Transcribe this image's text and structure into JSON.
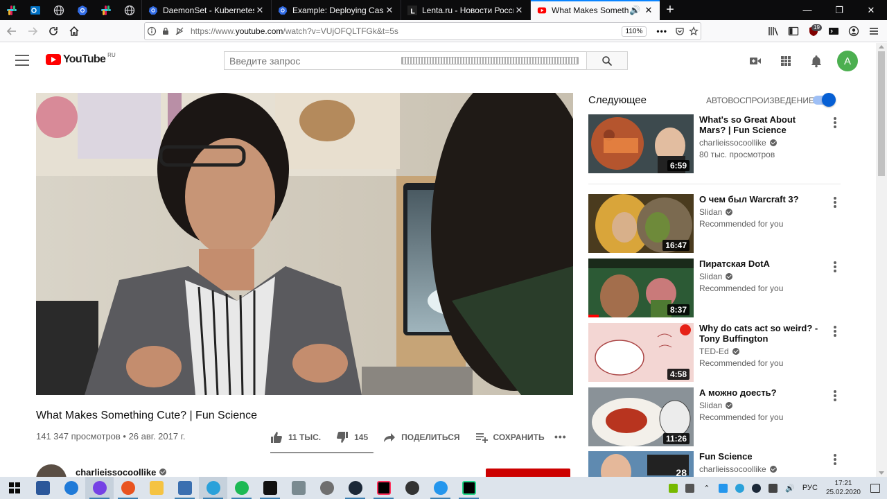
{
  "browser": {
    "pinned_tabs": [
      {
        "icon": "slack-icon",
        "color": "#e01e5a"
      },
      {
        "icon": "outlook-icon",
        "color": "#0072c6"
      },
      {
        "icon": "globe-icon",
        "color": "#d7d7db"
      },
      {
        "icon": "kubernetes-icon",
        "color": "#326ce5"
      },
      {
        "icon": "slack-icon",
        "color": "#e01e5a"
      },
      {
        "icon": "globe-icon",
        "color": "#d7d7db"
      }
    ],
    "tabs": [
      {
        "title": "DaemonSet - Kubernetes",
        "icon": "kubernetes-icon"
      },
      {
        "title": "Example: Deploying Cassandra",
        "icon": "kubernetes-icon"
      },
      {
        "title": "Lenta.ru - Новости России и м",
        "icon": "lenta-icon"
      },
      {
        "title": "What Makes Something Cut",
        "icon": "youtube-icon"
      }
    ],
    "url_prefix": "https://www.",
    "url_host": "youtube.com",
    "url_path": "/watch?v=VUjOFQLTFGk&t=5s",
    "zoom": "110%",
    "addon_badge": "19"
  },
  "youtube": {
    "logo_text": "YouTube",
    "region": "RU",
    "search_placeholder": "Введите запрос",
    "avatar_letter": "A",
    "brand_color": "#ff0000",
    "accent_color": "#065fd4"
  },
  "video": {
    "title": "What Makes Something Cute? | Fun Science",
    "meta": "141 347 просмотров • 26 авг. 2017 г.",
    "likes": "11 ТЫС.",
    "dislikes": "145",
    "share_label": "ПОДЕЛИТЬСЯ",
    "save_label": "СОХРАНИТЬ",
    "like_ratio": 0.987,
    "channel": "charlieissocoollike"
  },
  "sidebar": {
    "up_next": "Следующее",
    "autoplay": "АВТОВОСПРОИЗВЕДЕНИЕ",
    "autoplay_on": true,
    "items": [
      {
        "title": "What's so Great About Mars? | Fun Science",
        "channel": "charlieissocoollike",
        "stat": "80 тыс. просмотров",
        "duration": "6:59",
        "progress": 0
      },
      {
        "title": "О чем был Warcraft 3?",
        "channel": "Slidan",
        "stat": "Recommended for you",
        "duration": "16:47",
        "progress": 0
      },
      {
        "title": "Пиратская DotA",
        "channel": "Slidan",
        "stat": "Recommended for you",
        "duration": "8:37",
        "progress": 0.1
      },
      {
        "title": "Why do cats act so weird? - Tony Buffington",
        "channel": "TED-Ed",
        "stat": "Recommended for you",
        "duration": "4:58",
        "progress": 0
      },
      {
        "title": "А можно доесть?",
        "channel": "Slidan",
        "stat": "Recommended for you",
        "duration": "11:26",
        "progress": 0
      },
      {
        "title": "Fun Science",
        "channel": "charlieissocoollike",
        "stat": "",
        "duration": "28",
        "progress": 0
      }
    ]
  },
  "taskbar": {
    "apps": [
      "windows-start-icon",
      "powershell-icon",
      "edge-icon",
      "firefox-icon",
      "ubuntu-icon",
      "file-explorer-icon",
      "network-app-icon",
      "telegram-icon",
      "spotify-icon",
      "terminal-icon",
      "feather-icon",
      "cloud-app-icon",
      "steam-icon",
      "intellij-icon",
      "settings-icon",
      "docker-icon",
      "pycharm-icon"
    ],
    "language": "РУС",
    "time": "17:21",
    "date": "25.02.2020"
  }
}
